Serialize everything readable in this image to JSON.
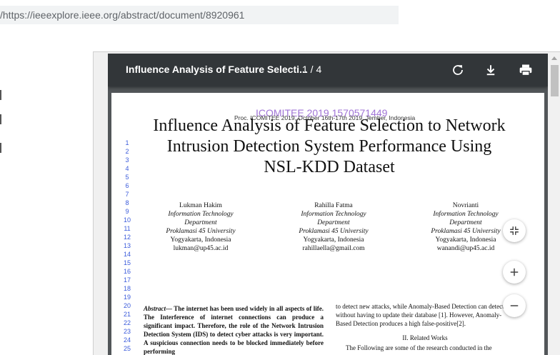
{
  "browser": {
    "url": "/https://ieeexplore.ieee.org/abstract/document/8920961"
  },
  "viewer": {
    "doc_title": "Influence Analysis of Feature Selecti...",
    "page_indicator": "1 / 4",
    "icons": {
      "rotate": "rotate-icon",
      "download": "download-icon",
      "print": "print-icon",
      "fit": "fit-page-icon",
      "zoom_in": "zoom-in-icon",
      "zoom_out": "zoom-out-icon"
    },
    "toolbar_color": "#323639",
    "background_color": "#525659"
  },
  "paper": {
    "watermark": "ICOMITEE 2019 1570571449",
    "conference_line": "Proc. ICOMITEE 2019, October 16th-17th 2019, Jember, Indonesia",
    "title_lines": [
      "Influence Analysis of Feature Selection to Network",
      "Intrusion Detection System Performance Using",
      "NSL-KDD Dataset"
    ],
    "line_numbers": [
      "1",
      "2",
      "3",
      "4",
      "5",
      "6",
      "7",
      "8",
      "9",
      "10",
      "11",
      "12",
      "13",
      "14",
      "15",
      "16",
      "17",
      "18",
      "19",
      "20",
      "21",
      "22",
      "23",
      "24",
      "25"
    ],
    "authors": [
      {
        "name": "Lukman Hakim",
        "dept1": "Information Technology",
        "dept2": "Department",
        "univ": "Proklamasi 45 University",
        "city": "Yogyakarta, Indonesia",
        "email": "lukman@up45.ac.id"
      },
      {
        "name": "Rahilla Fatma",
        "dept1": "Information Technology",
        "dept2": "Department",
        "univ": "Proklamasi 45 University",
        "city": "Yogyakarta, Indonesia",
        "email": "rahillaella@gmail.com"
      },
      {
        "name": "Novrianti",
        "dept1": "Information Technology",
        "dept2": "Department",
        "univ": "Proklamasi 45 University",
        "city": "Yogyakarta, Indonesia",
        "email": "wanandi@up45.ac.id"
      }
    ],
    "abstract_label": "Abstract—",
    "abstract_text": " The internet has been used widely in all aspects of life. The Interference of internet connections can produce a significant impact. Therefore, the role of the Network Intrusion Detection System (IDS) to detect cyber attacks is very important. A suspicious connection needs to be blocked immediately before performing",
    "right_col_text": "to detect new attacks, while Anomaly-Based Detection can detect without having to update their database [1]. However, Anomaly-Based Detection produces a high false-positive[2].",
    "section_heading": "II. Related Works",
    "section_first_line": "The Following are some of the research conducted in the"
  }
}
